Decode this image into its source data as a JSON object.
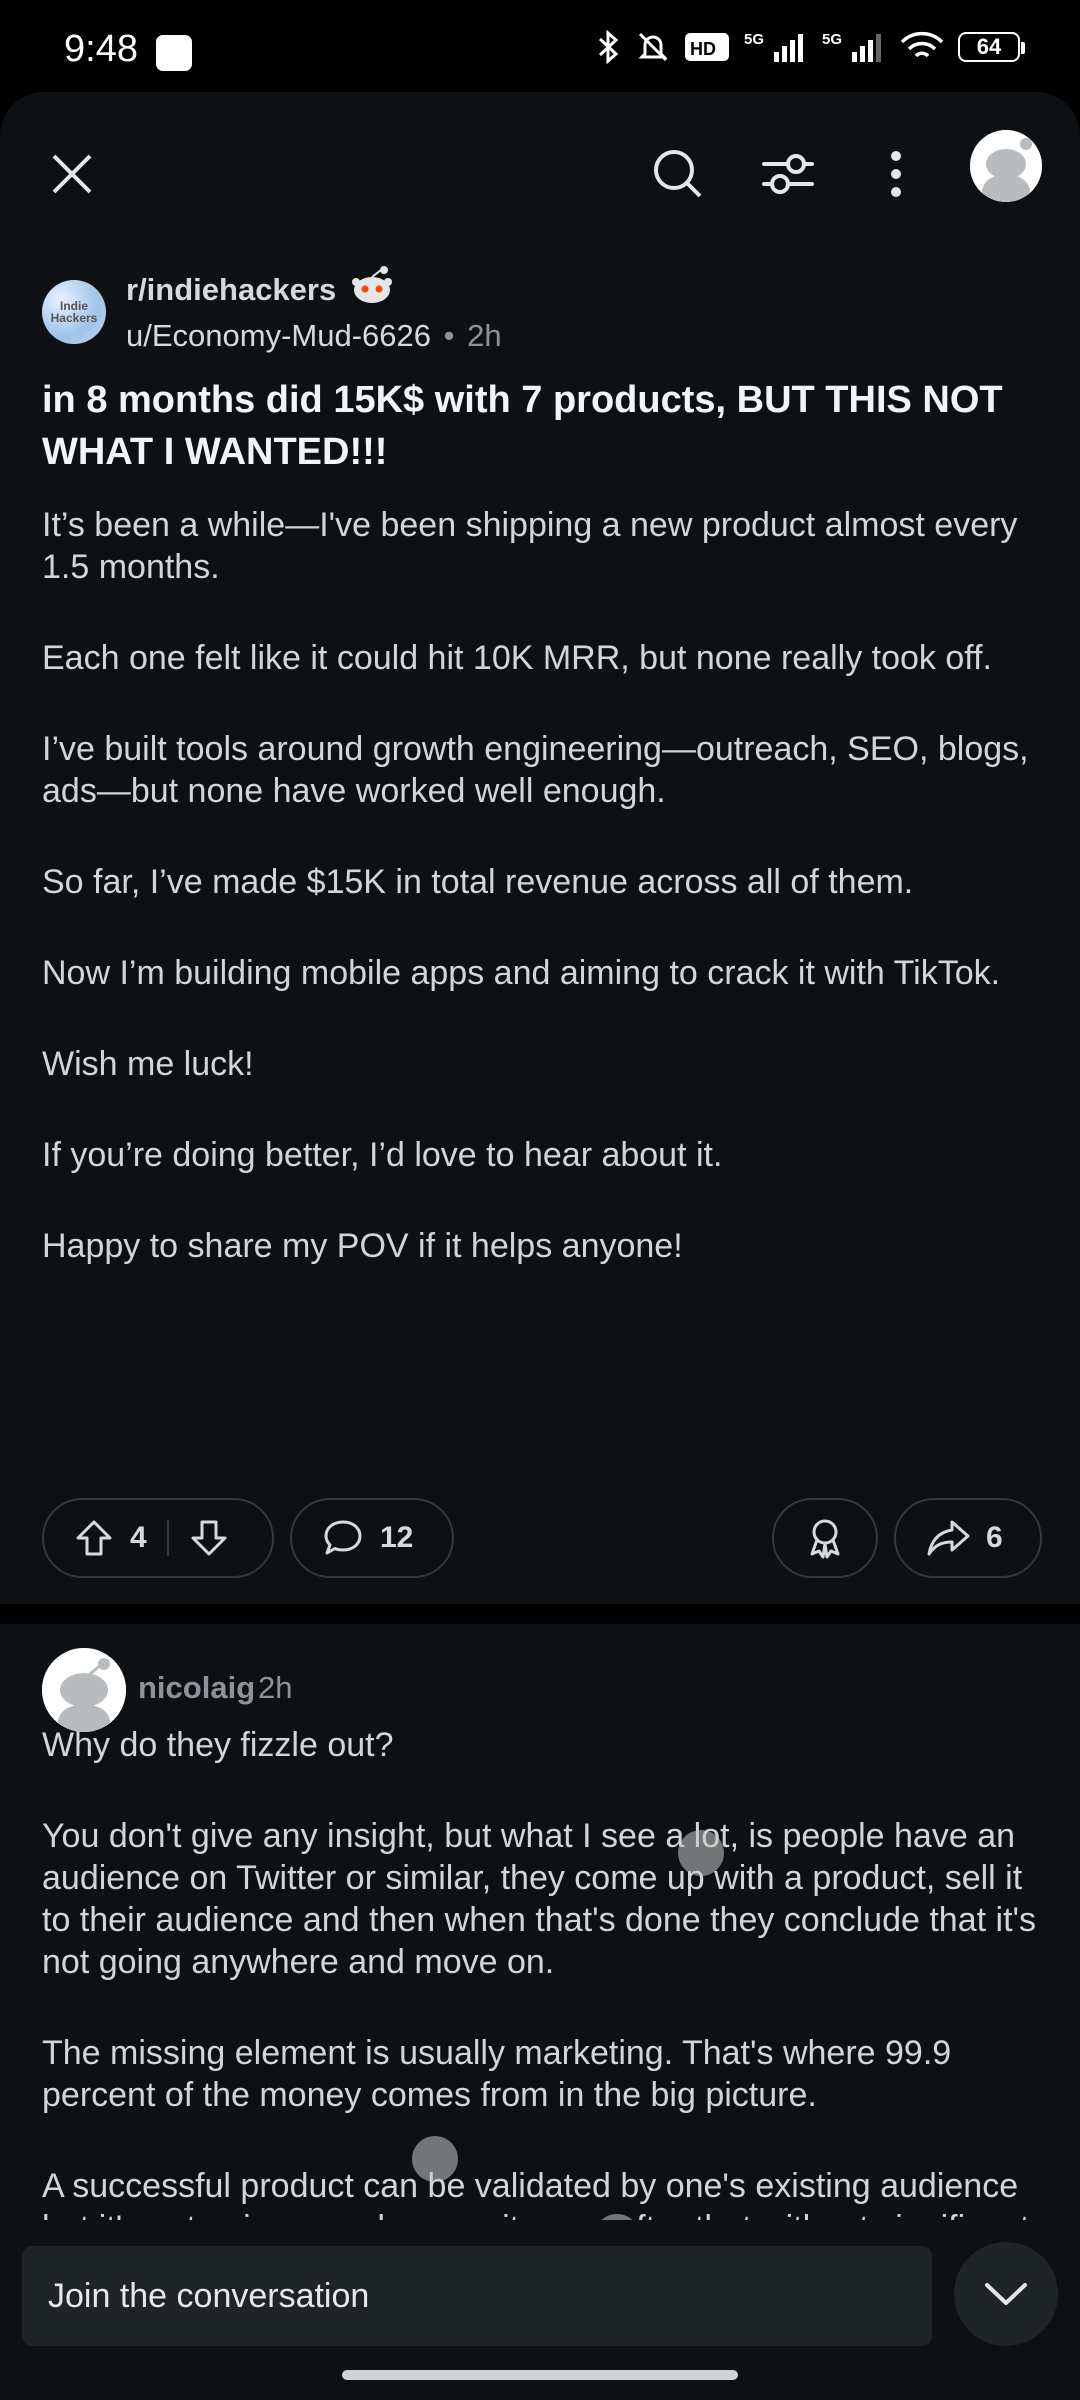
{
  "status": {
    "time": "9:48",
    "battery": "64",
    "icons": [
      "bluetooth-icon",
      "bell-off-icon",
      "hd-voice-icon",
      "signal-5g-icon",
      "signal-5g-icon",
      "wifi-icon"
    ]
  },
  "topbar": {
    "icons": [
      "close-icon",
      "search-icon",
      "filter-icon",
      "more-vertical-icon",
      "profile-avatar"
    ]
  },
  "post": {
    "subreddit": "r/indiehackers",
    "subreddit_avatar_text": "Indie Hackers",
    "author": "u/Economy-Mud-6626",
    "separator": "•",
    "age": "2h",
    "title": "in 8 months did 15K$ with 7 products, BUT THIS NOT WHAT I WANTED!!!",
    "body": [
      "It’s been a while—I've been shipping a new product almost every 1.5 months.",
      "Each one felt like it could hit 10K MRR, but none really took off.",
      "I’ve built tools around growth engineering—outreach, SEO, blogs, ads—but none have worked well enough.",
      "So far, I’ve made $15K in total revenue across all of them.",
      "Now I’m building mobile apps and aiming to crack it with TikTok.",
      "Wish me luck!",
      "If you’re doing better, I’d love to hear about it.",
      "Happy to share my POV if it helps anyone!"
    ],
    "votes": "4",
    "comments": "12",
    "shares": "6"
  },
  "comment": {
    "user": "nicolaig",
    "age": "2h",
    "body": [
      "Why do they fizzle out?",
      "You don't give any insight, but what I see a lot, is people have an audience on Twitter or similar, they come up with a product, sell it to their audience and then when that's done they conclude that it's not going anywhere and move on.",
      "The missing element is usually marketing. That's where 99.9 percent of the money comes from in the big picture.",
      "A successful product can be validated by one's existing audience but it's not going anywhere on its own after that without significant effort and time spent marketing."
    ]
  },
  "reply": {
    "placeholder": "Join the conversation"
  },
  "colors": {
    "background": "#0e1113",
    "text": "#d7dadc",
    "muted": "#8d9499",
    "pill_border": "#33393d",
    "input_bg": "#1f2426"
  }
}
